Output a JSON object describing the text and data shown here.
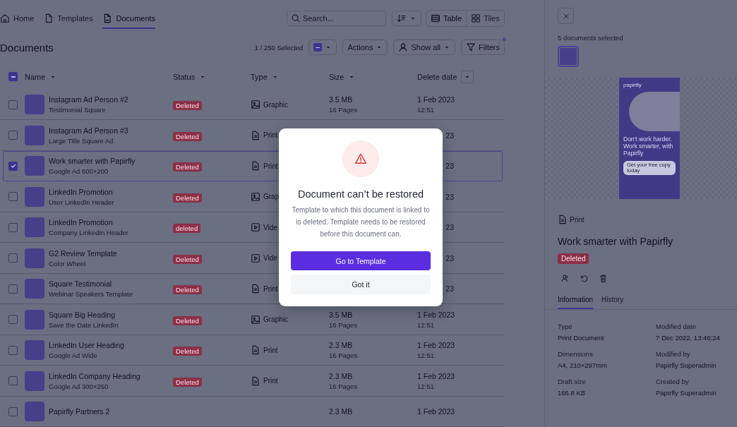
{
  "nav": {
    "tabs": [
      {
        "label": "Home",
        "selected": false
      },
      {
        "label": "Templates",
        "selected": false
      },
      {
        "label": "Documents",
        "selected": true
      }
    ],
    "search": {
      "placeholder": "Search..."
    },
    "views": [
      {
        "label": "Table",
        "selected": true
      },
      {
        "label": "Tiles",
        "selected": false
      }
    ]
  },
  "toolbar": {
    "title": "Documents",
    "selection_count": "1 / 250 Selected",
    "actions": "Actions",
    "show_all": "Show all",
    "filters": "Filters",
    "filters_active": true
  },
  "table": {
    "select_all": {
      "indeterminate": true
    },
    "columns": [
      "Name",
      "Status",
      "Type",
      "Size",
      "Delete date"
    ],
    "rows": [
      {
        "title": "Instagram Ad Person #2",
        "subtitle": "Testimonial Square",
        "status": "Deleted",
        "kind": "graphic",
        "type": "Graphic",
        "size": "3.5 MB",
        "pages": "16 Pages",
        "date": "1 Feb 2023",
        "time": "12:51",
        "selected": false
      },
      {
        "title": "Instagram Ad Person #3",
        "subtitle": "Large Title Square Ad",
        "status": "Deleted",
        "kind": "print",
        "type": "Print",
        "date": "23",
        "selected": false
      },
      {
        "title": "Work smarter with Papirfly",
        "subtitle": "Google Ad 600×200",
        "status": "Deleted",
        "kind": "print",
        "type": "Print",
        "date": "23",
        "selected": true
      },
      {
        "title": "LinkedIn Promotion",
        "subtitle": "User LinkedIn Header",
        "status": "Deleted",
        "kind": "graphic",
        "type": "Grap",
        "date": "23",
        "selected": false
      },
      {
        "title": "LinkedIn Promotion",
        "subtitle": "Company LinkedIn Header",
        "status": "deleted",
        "kind": "video",
        "type": "Vide",
        "date": "23",
        "selected": false
      },
      {
        "title": "G2 Review Template",
        "subtitle": "Color Wheel",
        "status": "Deleted",
        "kind": "video",
        "type": "Vide",
        "date": "23",
        "selected": false
      },
      {
        "title": "Square Testimonial",
        "subtitle": "Webinar Speakers Template",
        "status": "Deleted",
        "kind": "print",
        "type": "Print",
        "date": "23",
        "selected": false
      },
      {
        "title": "Square Big Heading",
        "subtitle": "Save the Date LinkedIn",
        "status": "Deleted",
        "kind": "graphic",
        "type": "Graphic",
        "size": "3.5 MB",
        "pages": "16 Pages",
        "date": "1 Feb 2023",
        "time": "12:51",
        "selected": false
      },
      {
        "title": "LinkedIn User Heading",
        "subtitle": "Google Ad Wide",
        "status": "Deleted",
        "kind": "print",
        "type": "Print",
        "size": "2.3 MB",
        "pages": "16 Pages",
        "date": "1 Feb 2023",
        "time": "12:51",
        "selected": false
      },
      {
        "title": "LinkedIn Company Heading",
        "subtitle": "Google Ad 300×250",
        "status": "Deleted",
        "kind": "print",
        "type": "Print",
        "size": "2.3 MB",
        "pages": "16 Pages",
        "date": "1 Feb 2023",
        "time": "12:51",
        "selected": false
      },
      {
        "title": "Papirfly Partners 2",
        "size": "2.3 MB",
        "date": "1 Feb 2023",
        "selected": false
      }
    ]
  },
  "panel": {
    "selected_count": "5 documents selected",
    "preview": {
      "logo": "papirfly",
      "headline": "Don't work harder. Work smarter, with Papirfly",
      "cta": "Get your free copy today"
    },
    "type": "Print",
    "title": "Work smarter with Papirfly",
    "status": "Deleted",
    "tabs": [
      {
        "label": "Information",
        "selected": true
      },
      {
        "label": "History",
        "selected": false
      }
    ],
    "fields": [
      {
        "label": "Type",
        "value": "Print Document"
      },
      {
        "label": "Modified date",
        "value": "7 Dec 2022, 13:46:24"
      },
      {
        "label": "Dimensions",
        "value": "A4, 210×297mm"
      },
      {
        "label": "Modified by",
        "value": "Papirfly Superadmin"
      },
      {
        "label": "Draft size",
        "value": "166.8 KB"
      },
      {
        "label": "Created by",
        "value": "Papirfly Superadmin"
      }
    ]
  },
  "dialog": {
    "title": "Document can’t be restored",
    "message": "Template to which this document is linked to is deleted. Template needs to be restored before this document can.",
    "primary": "Go to Template",
    "secondary": "Got it"
  }
}
